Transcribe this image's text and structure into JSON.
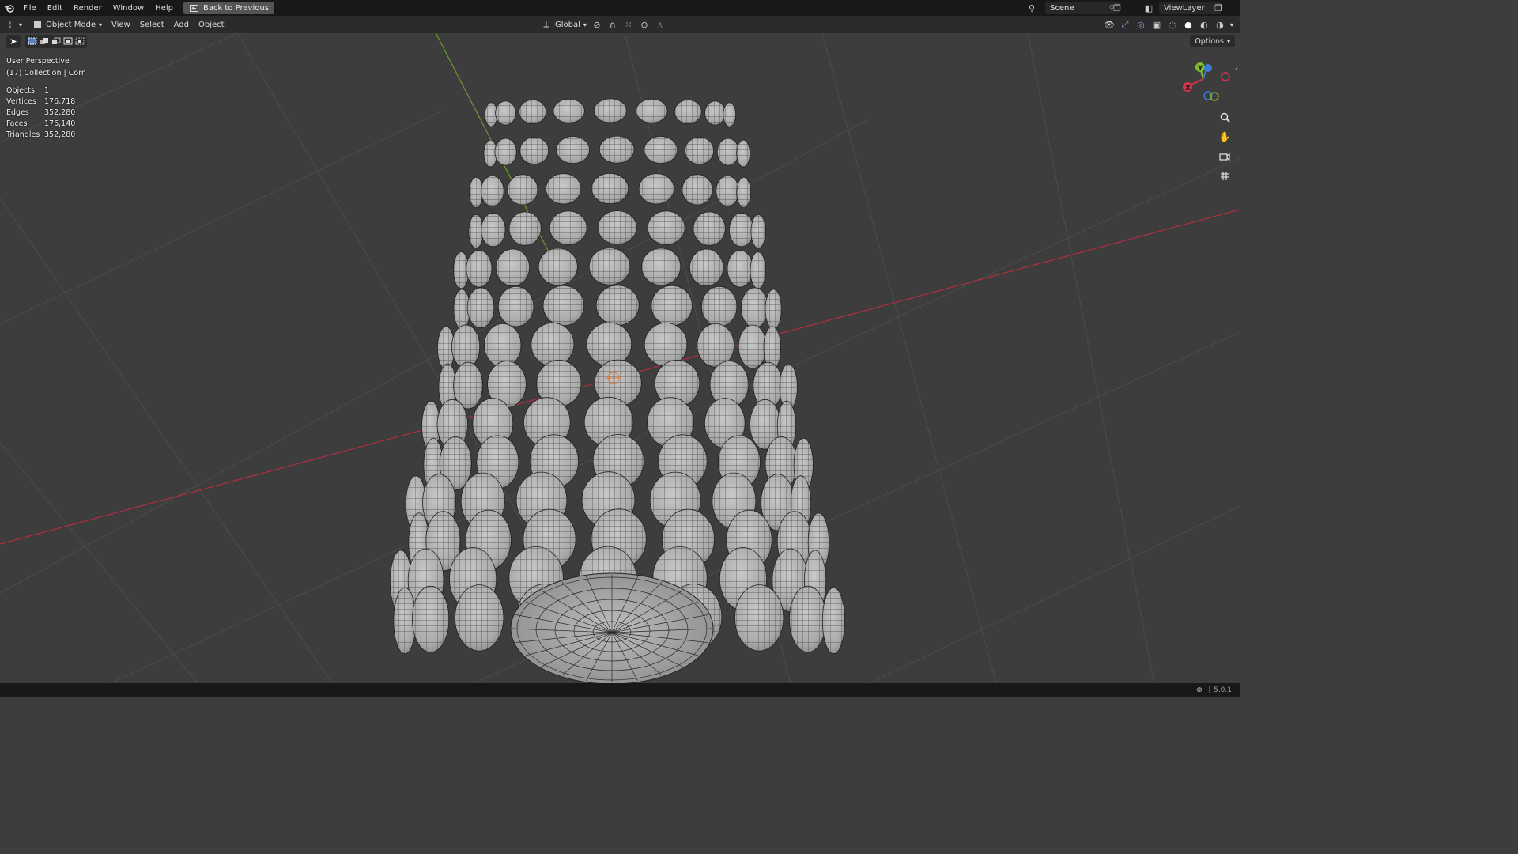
{
  "top_menu": {
    "items": [
      "File",
      "Edit",
      "Render",
      "Window",
      "Help"
    ],
    "back_button": "Back to Previous",
    "scene_label": "Scene",
    "view_layer_label": "ViewLayer"
  },
  "viewport_header": {
    "mode": "Object Mode",
    "menus": [
      "View",
      "Select",
      "Add",
      "Object"
    ],
    "transform_orientation": "Global",
    "options_label": "Options"
  },
  "overlay": {
    "view_name": "User Perspective",
    "collection": "(17) Collection | Corn",
    "stats": [
      {
        "label": "Objects",
        "value": "1"
      },
      {
        "label": "Vertices",
        "value": "176,718"
      },
      {
        "label": "Edges",
        "value": "352,280"
      },
      {
        "label": "Faces",
        "value": "176,140"
      },
      {
        "label": "Triangles",
        "value": "352,280"
      }
    ]
  },
  "gizmo": {
    "axes": [
      "X",
      "Y",
      "Z"
    ],
    "colors": {
      "x": "#d6344c",
      "y": "#7fbb2f",
      "z": "#3b7ad8"
    }
  },
  "status_bar": {
    "version": "5.0.1"
  },
  "icons": {
    "logo": "blender-logo",
    "zoom": "zoom-icon",
    "pan": "hand-icon",
    "camera": "camera-icon",
    "grid": "grid-icon"
  }
}
